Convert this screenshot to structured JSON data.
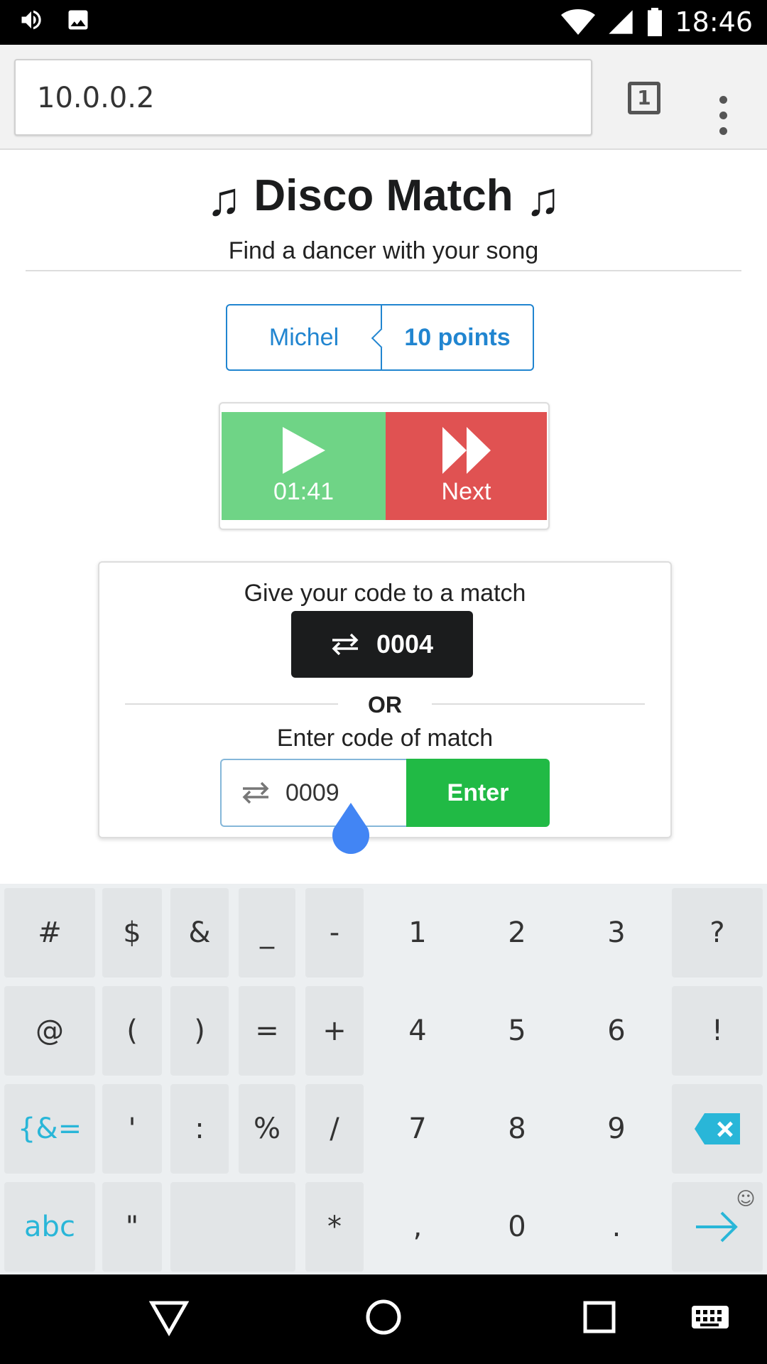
{
  "status_bar": {
    "clock": "18:46",
    "icons": [
      "volume-icon",
      "image-icon",
      "wifi-icon",
      "signal-icon",
      "battery-icon"
    ]
  },
  "browser": {
    "url": "10.0.0.2",
    "tab_count": "1",
    "menu_icon": "more-vert-icon"
  },
  "page": {
    "title": "Disco Match",
    "title_icon": "music-note-icon",
    "subtitle": "Find a dancer with your song",
    "player": {
      "name": "Michel",
      "points": "10 points"
    },
    "controls": {
      "play_time": "01:41",
      "next_label": "Next",
      "play_color": "#6fd486",
      "next_color": "#e05252"
    },
    "match_card": {
      "give_label": "Give your code to a match",
      "my_code": "0004",
      "or_label": "OR",
      "enter_label": "Enter code of match",
      "input_value": "0009",
      "enter_button": "Enter",
      "enter_color": "#21ba45"
    }
  },
  "keyboard": {
    "rows": [
      [
        "#",
        "$",
        "&",
        "_",
        "-",
        "1",
        "2",
        "3",
        "?"
      ],
      [
        "@",
        "(",
        ")",
        "=",
        "+",
        "4",
        "5",
        "6",
        "!"
      ],
      [
        "{&=",
        "'",
        ":",
        "%",
        "/",
        "7",
        "8",
        "9",
        "backspace"
      ],
      [
        "abc",
        "\"",
        "",
        "*",
        ",",
        "0",
        ".",
        "enter"
      ]
    ],
    "accent_color": "#29b6d8"
  },
  "nav_bar": {
    "icons": [
      "back-icon",
      "home-icon",
      "recents-icon",
      "keyboard-icon"
    ]
  }
}
